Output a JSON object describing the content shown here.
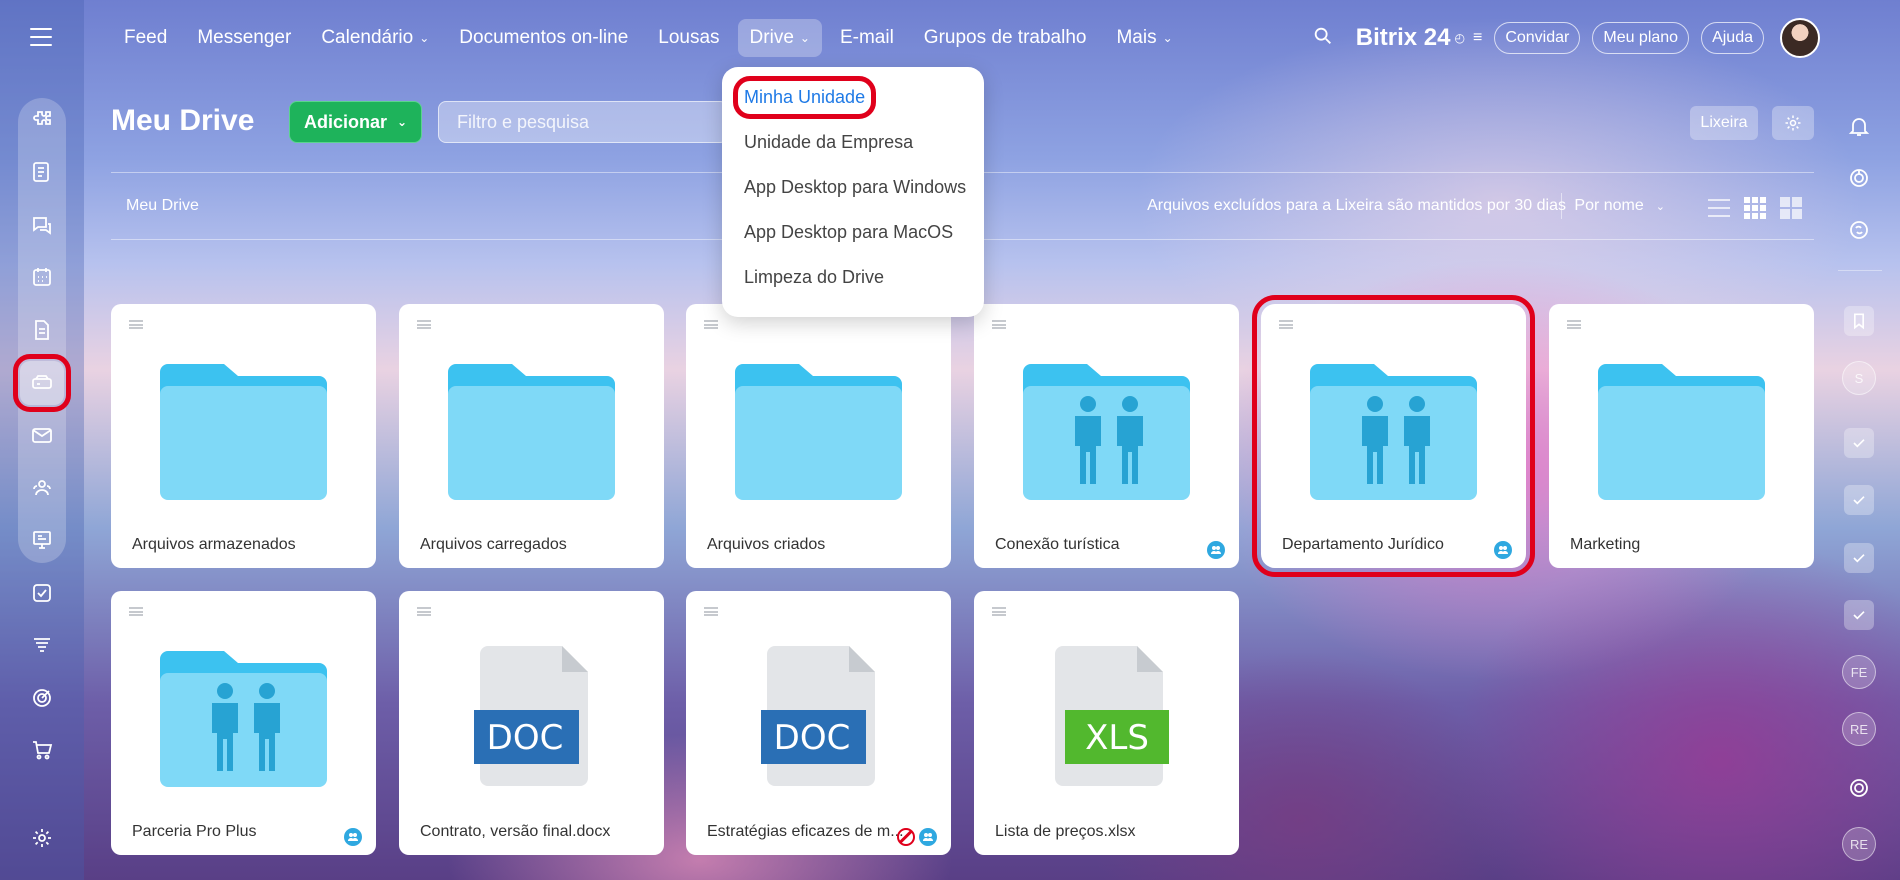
{
  "top_nav": {
    "items": [
      {
        "label": "Feed",
        "has_dropdown": false
      },
      {
        "label": "Messenger",
        "has_dropdown": false
      },
      {
        "label": "Calendário",
        "has_dropdown": true
      },
      {
        "label": "Documentos on-line",
        "has_dropdown": false
      },
      {
        "label": "Lousas",
        "has_dropdown": false
      },
      {
        "label": "Drive",
        "has_dropdown": true,
        "selected": true
      },
      {
        "label": "E-mail",
        "has_dropdown": false
      },
      {
        "label": "Grupos de trabalho",
        "has_dropdown": false
      },
      {
        "label": "Mais",
        "has_dropdown": true
      }
    ],
    "brand": "Bitrix 24",
    "invite_label": "Convidar",
    "plan_label": "Meu plano",
    "help_label": "Ajuda"
  },
  "drive_menu": {
    "items": [
      {
        "label": "Minha Unidade",
        "highlighted": true
      },
      {
        "label": "Unidade da Empresa"
      },
      {
        "label": "App Desktop para Windows"
      },
      {
        "label": "App Desktop para MacOS"
      },
      {
        "label": "Limpeza do Drive"
      }
    ]
  },
  "header": {
    "title": "Meu Drive",
    "add_label": "Adicionar",
    "search_placeholder": "Filtro e pesquisa",
    "trash_label": "Lixeira"
  },
  "crumb_bar": {
    "breadcrumb": "Meu Drive",
    "retention_note": "Arquivos excluídos para a Lixeira são mantidos por 30 dias",
    "sort_label": "Por nome"
  },
  "cards": [
    {
      "title": "Arquivos armazenados",
      "kind": "folder"
    },
    {
      "title": "Arquivos carregados",
      "kind": "folder"
    },
    {
      "title": "Arquivos criados",
      "kind": "folder"
    },
    {
      "title": "Conexão turística",
      "kind": "shared-folder",
      "shared": true
    },
    {
      "title": "Departamento Jurídico",
      "kind": "shared-folder",
      "shared": true,
      "highlighted": true
    },
    {
      "title": "Marketing",
      "kind": "folder"
    },
    {
      "title": "Parceria Pro Plus",
      "kind": "shared-folder",
      "shared": true
    },
    {
      "title": "Contrato, versão final.docx",
      "kind": "doc",
      "badge": "DOC"
    },
    {
      "title": "Estratégias eficazes de m...",
      "kind": "doc",
      "badge": "DOC",
      "shared": true,
      "blocked": true
    },
    {
      "title": "Lista de preços.xlsx",
      "kind": "xls",
      "badge": "XLS"
    }
  ],
  "right_rail": {
    "avatars": [
      "S",
      "FE",
      "RE",
      "RE"
    ]
  },
  "colors": {
    "accent_green": "#1eb35b",
    "highlight_red": "#e0001b",
    "folder_blue": "#7fd9f7",
    "folder_tab_blue": "#3cc2f0",
    "doc_blue": "#2a6fb5",
    "xls_green": "#52b82e",
    "link_blue": "#1f7ae6"
  }
}
